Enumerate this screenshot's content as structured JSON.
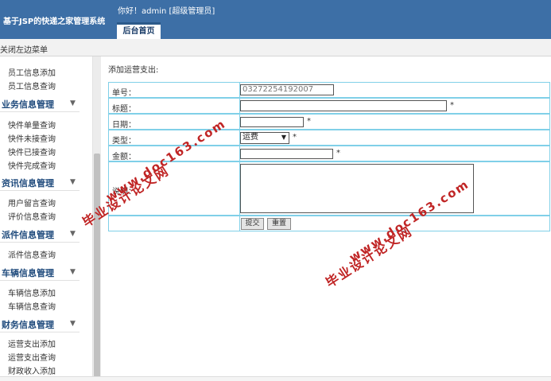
{
  "header": {
    "site_title": "基于JSP的快递之家管理系统",
    "greeting": "你好！admin [超级管理员]",
    "home_tab": "后台首页"
  },
  "subbar": {
    "close_menu": "关闭左边菜单"
  },
  "sidebar": {
    "items_top": [
      "员工信息添加",
      "员工信息查询"
    ],
    "sections": [
      {
        "title": "业务信息管理",
        "items": [
          "快件单量查询",
          "快件未接查询",
          "快件已接查询",
          "快件完成查询"
        ]
      },
      {
        "title": "资讯信息管理",
        "items": [
          "用户留言查询",
          "评价信息查询"
        ]
      },
      {
        "title": "派件信息管理",
        "items": [
          "派件信息查询"
        ]
      },
      {
        "title": "车辆信息管理",
        "items": [
          "车辆信息添加",
          "车辆信息查询"
        ]
      },
      {
        "title": "财务信息管理",
        "items": [
          "运营支出添加",
          "运营支出查询",
          "财政收入添加"
        ]
      }
    ],
    "chevron": "▼"
  },
  "form": {
    "title": "添加运营支出:",
    "number_label": "单号：",
    "number_value": "03272254192007",
    "title_label": "标题：",
    "date_label": "日期：",
    "type_label": "类型：",
    "type_value": "运费",
    "amount_label": "金额：",
    "remark_label": "说明：",
    "required_mark": "*",
    "submit_label": "提交",
    "reset_label": "重置"
  },
  "watermarks": [
    "毕业设计论文网",
    "www.doc163.com"
  ]
}
